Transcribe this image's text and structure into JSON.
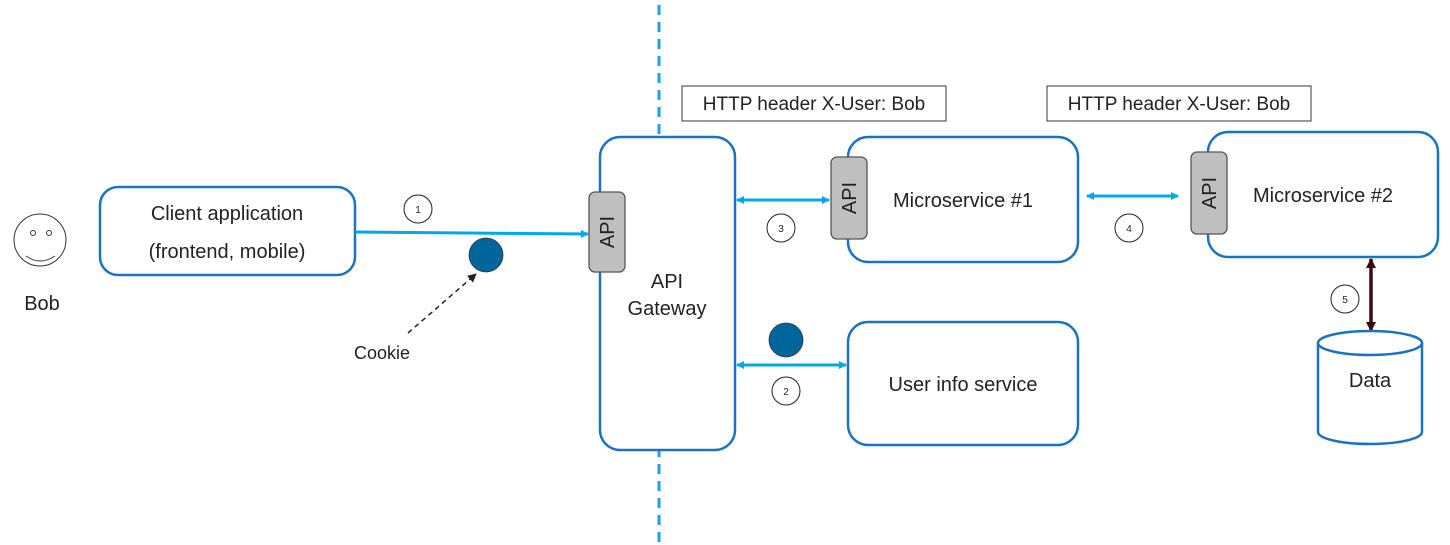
{
  "colors": {
    "box_stroke": "#1a73c0",
    "arrow": "#00a8e8",
    "cookie": "#00659b",
    "boundary": "#1ea0e6",
    "db_arrow": "#3a0a10",
    "api_tab": "#bfbfbf"
  },
  "actor": {
    "name": "Bob",
    "icon": "smiley-face-icon"
  },
  "client": {
    "line1": "Client application",
    "line2": "(frontend, mobile)"
  },
  "cookie_label": "Cookie",
  "gateway": {
    "line1": "API",
    "line2": "Gateway",
    "api_tab": "API"
  },
  "headers": [
    "HTTP header X-User: Bob",
    "HTTP header X-User: Bob"
  ],
  "microservice1": {
    "label": "Microservice #1",
    "api_tab": "API"
  },
  "microservice2": {
    "label": "Microservice #2",
    "api_tab": "API"
  },
  "user_info": {
    "label": "User info service"
  },
  "data_store": {
    "label": "Data"
  },
  "steps": [
    "1",
    "2",
    "3",
    "4",
    "5"
  ]
}
